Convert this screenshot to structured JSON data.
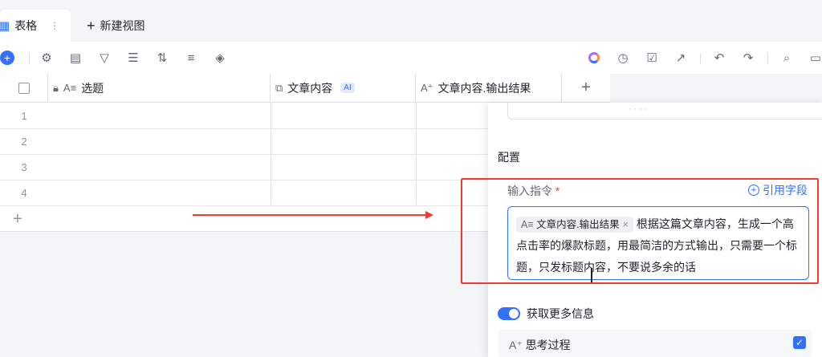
{
  "tabs": {
    "active_label": "表格",
    "new_view_label": "新建视图"
  },
  "table": {
    "columns": [
      {
        "label": "选题",
        "icon": "text-icon"
      },
      {
        "label": "文章内容",
        "icon": "link-icon",
        "badge": "AI"
      },
      {
        "label": "文章内容.输出结果",
        "icon": "ai-text-icon"
      }
    ],
    "rows": [
      "1",
      "2",
      "3",
      "4"
    ]
  },
  "panel": {
    "section_title": "配置",
    "instruction_label": "输入指令",
    "required_mark": "*",
    "reference_link": "引用字段",
    "chip_label": "文章内容.输出结果",
    "instruction_text": "根据这篇文章内容，生成一个高点击率的爆款标题，用最简洁的方式输出，只需要一个标题，只发标题内容，不要说多余的话",
    "toggle_label": "获取更多信息",
    "thinking_label": "思考过程"
  },
  "colors": {
    "accent": "#3370ff",
    "highlight": "#ef3b34"
  }
}
